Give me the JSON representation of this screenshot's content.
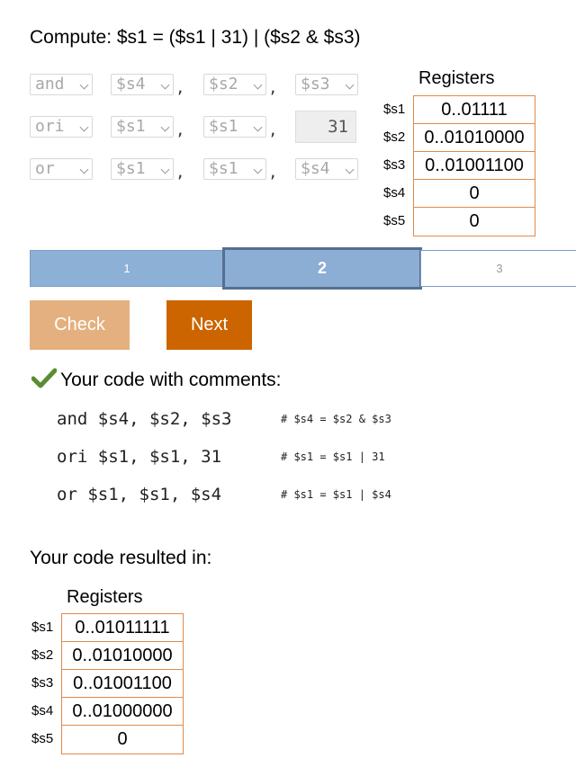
{
  "title": "Compute: $s1 = ($s1 | 31) | ($s2 & $s3)",
  "instructions": [
    {
      "op": "and",
      "rd": "$s4",
      "rs": "$s2",
      "rt": "$s3",
      "sep1": ",",
      "sep2": ","
    },
    {
      "op": "ori",
      "rd": "$s1",
      "rs": "$s1",
      "imm": "31",
      "sep1": ",",
      "sep2": ","
    },
    {
      "op": "or",
      "rd": "$s1",
      "rs": "$s1",
      "rt": "$s4",
      "sep1": ",",
      "sep2": ","
    }
  ],
  "registers_top": {
    "title": "Registers",
    "rows": [
      {
        "name": "$s1",
        "value": "0..01111"
      },
      {
        "name": "$s2",
        "value": "0..01010000"
      },
      {
        "name": "$s3",
        "value": "0..01001100"
      },
      {
        "name": "$s4",
        "value": "0"
      },
      {
        "name": "$s5",
        "value": "0"
      }
    ]
  },
  "steps": [
    {
      "label": "1",
      "state": "done"
    },
    {
      "label": "2",
      "state": "current"
    },
    {
      "label": "3",
      "state": "pending"
    }
  ],
  "buttons": {
    "check": "Check",
    "next": "Next"
  },
  "colors": {
    "check_button": "#e5b07f",
    "next_button": "#cc6400",
    "step_done": "#8db0d6",
    "step_current": "#8cadd4",
    "register_border": "#e08a4a"
  },
  "result": {
    "heading": "Your code with comments:",
    "code": [
      {
        "line": "and $s4, $s2, $s3",
        "comment": "# $s4 = $s2 & $s3"
      },
      {
        "line": "ori $s1, $s1, 31",
        "comment": "# $s1 = $s1 | 31"
      },
      {
        "line": "or $s1, $s1, $s4",
        "comment": "# $s1 = $s1 | $s4"
      }
    ]
  },
  "resulted_label": "Your code resulted in:",
  "registers_result": {
    "title": "Registers",
    "rows": [
      {
        "name": "$s1",
        "value": "0..01011111"
      },
      {
        "name": "$s2",
        "value": "0..01010000"
      },
      {
        "name": "$s3",
        "value": "0..01001100"
      },
      {
        "name": "$s4",
        "value": "0..01000000"
      },
      {
        "name": "$s5",
        "value": "0"
      }
    ]
  }
}
